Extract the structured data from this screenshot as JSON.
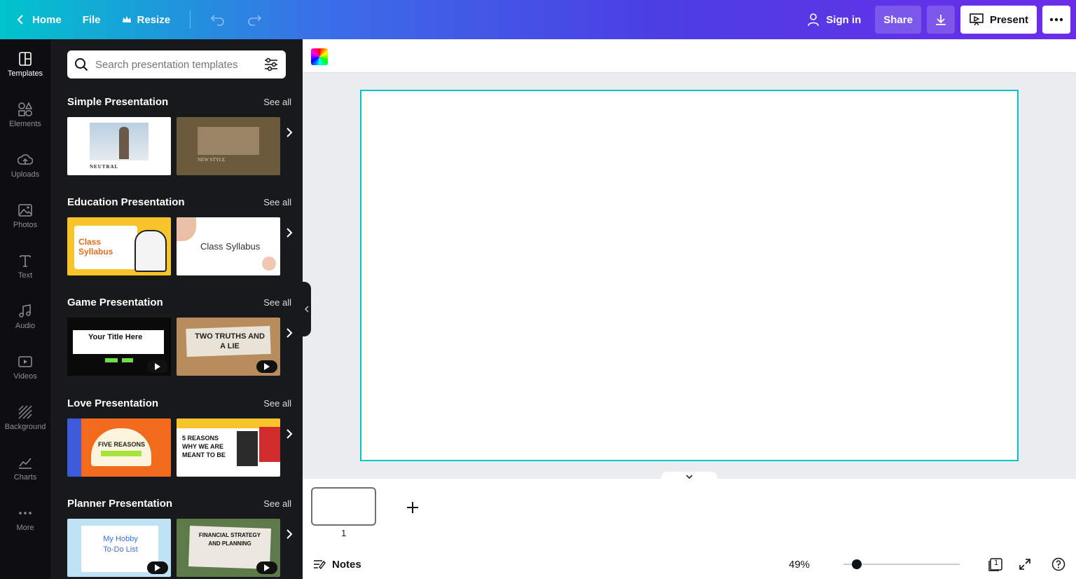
{
  "topbar": {
    "home": "Home",
    "file": "File",
    "resize": "Resize",
    "sign_in": "Sign in",
    "share": "Share",
    "present": "Present"
  },
  "rail": [
    {
      "label": "Templates",
      "icon": "templates-icon"
    },
    {
      "label": "Elements",
      "icon": "elements-icon"
    },
    {
      "label": "Uploads",
      "icon": "uploads-icon"
    },
    {
      "label": "Photos",
      "icon": "photos-icon"
    },
    {
      "label": "Text",
      "icon": "text-icon"
    },
    {
      "label": "Audio",
      "icon": "audio-icon"
    },
    {
      "label": "Videos",
      "icon": "videos-icon"
    },
    {
      "label": "Background",
      "icon": "background-icon"
    },
    {
      "label": "Charts",
      "icon": "charts-icon"
    },
    {
      "label": "More",
      "icon": "more-icon"
    }
  ],
  "search": {
    "placeholder": "Search presentation templates"
  },
  "sections": [
    {
      "title": "Simple Presentation",
      "see_all": "See all",
      "thumbs": [
        {
          "text": "NEUTRAL"
        },
        {
          "text": "NEW STYLE"
        }
      ]
    },
    {
      "title": "Education Presentation",
      "see_all": "See all",
      "thumbs": [
        {
          "text": "Class Syllabus"
        },
        {
          "text": "Class Syllabus"
        }
      ]
    },
    {
      "title": "Game Presentation",
      "see_all": "See all",
      "thumbs": [
        {
          "text": "Your Title Here"
        },
        {
          "text": "TWO TRUTHS AND A LIE"
        }
      ]
    },
    {
      "title": "Love Presentation",
      "see_all": "See all",
      "thumbs": [
        {
          "text": "FIVE REASONS"
        },
        {
          "text": "5 REASONS WHY WE ARE MEANT TO BE"
        }
      ]
    },
    {
      "title": "Planner Presentation",
      "see_all": "See all",
      "thumbs": [
        {
          "text": "My Hobby To-Do List"
        },
        {
          "text": "FINANCIAL STRATEGY AND PLANNING"
        }
      ]
    }
  ],
  "pages": {
    "current": "1"
  },
  "status": {
    "notes": "Notes",
    "zoom": "49%",
    "page_count": "1",
    "zoom_fraction": 0.1
  },
  "colors": {
    "accent": "#00c4cc",
    "panel": "#18191b",
    "rail": "#0e0e11"
  }
}
